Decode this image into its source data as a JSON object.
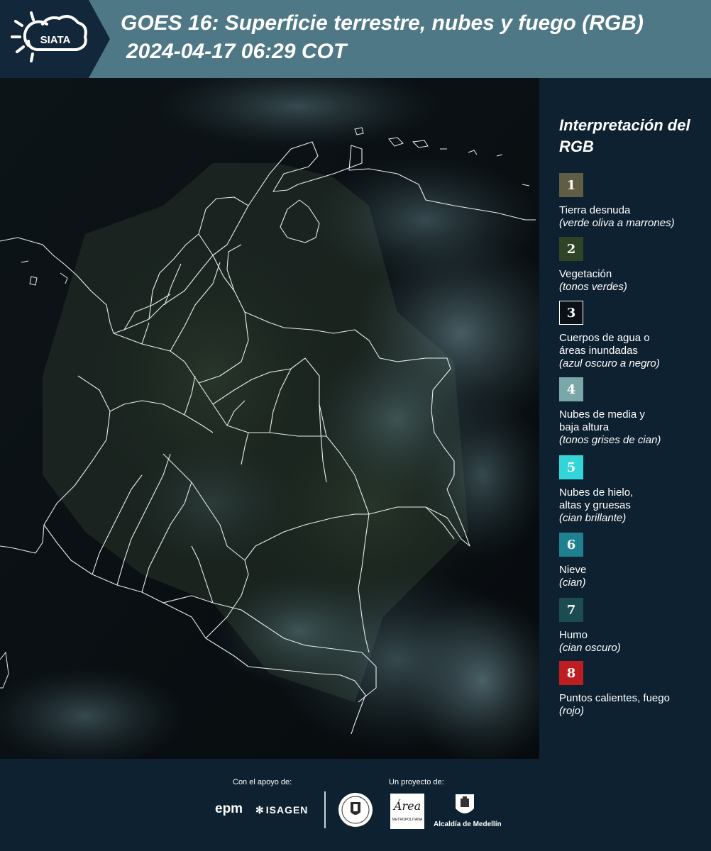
{
  "header": {
    "logo_text": "SIATA",
    "title_line1": "GOES 16: Superficie terrestre, nubes y fuego (RGB)",
    "title_line2": "2024-04-17 06:29 COT"
  },
  "legend": {
    "title": "Interpretación del RGB",
    "items": [
      {
        "number": "1",
        "label": "Tierra desnuda",
        "desc": "(verde oliva a marrones)",
        "color": "#5f5d44"
      },
      {
        "number": "2",
        "label": "Vegetación",
        "desc": "(tonos verdes)",
        "color": "#2f4427"
      },
      {
        "number": "3",
        "label": "Cuerpos de agua o\náreas inundadas",
        "desc": "(azul oscuro a negro)",
        "color": "#0a1016"
      },
      {
        "number": "4",
        "label": "Nubes de media y\nbaja altura",
        "desc": "(tonos grises de cian)",
        "color": "#7aa8a8"
      },
      {
        "number": "5",
        "label": "Nubes de hielo,\naltas y gruesas",
        "desc": "(cian brillante)",
        "color": "#33d6d8"
      },
      {
        "number": "6",
        "label": "Nieve",
        "desc": "(cian)",
        "color": "#1f8090"
      },
      {
        "number": "7",
        "label": "Humo",
        "desc": "(cian oscuro)",
        "color": "#1c4b50"
      },
      {
        "number": "8",
        "label": "Puntos calientes, fuego",
        "desc": "(rojo)",
        "color": "#be1e22"
      }
    ]
  },
  "footer": {
    "support_label": "Con el apoyo de:",
    "project_label": "Un proyecto de:",
    "sponsors": [
      "epm",
      "ISAGEN"
    ],
    "area_logo_text": "Área",
    "area_logo_sub": "METROPOLITANA",
    "alcaldia_label": "Alcaldía de Medellín"
  }
}
